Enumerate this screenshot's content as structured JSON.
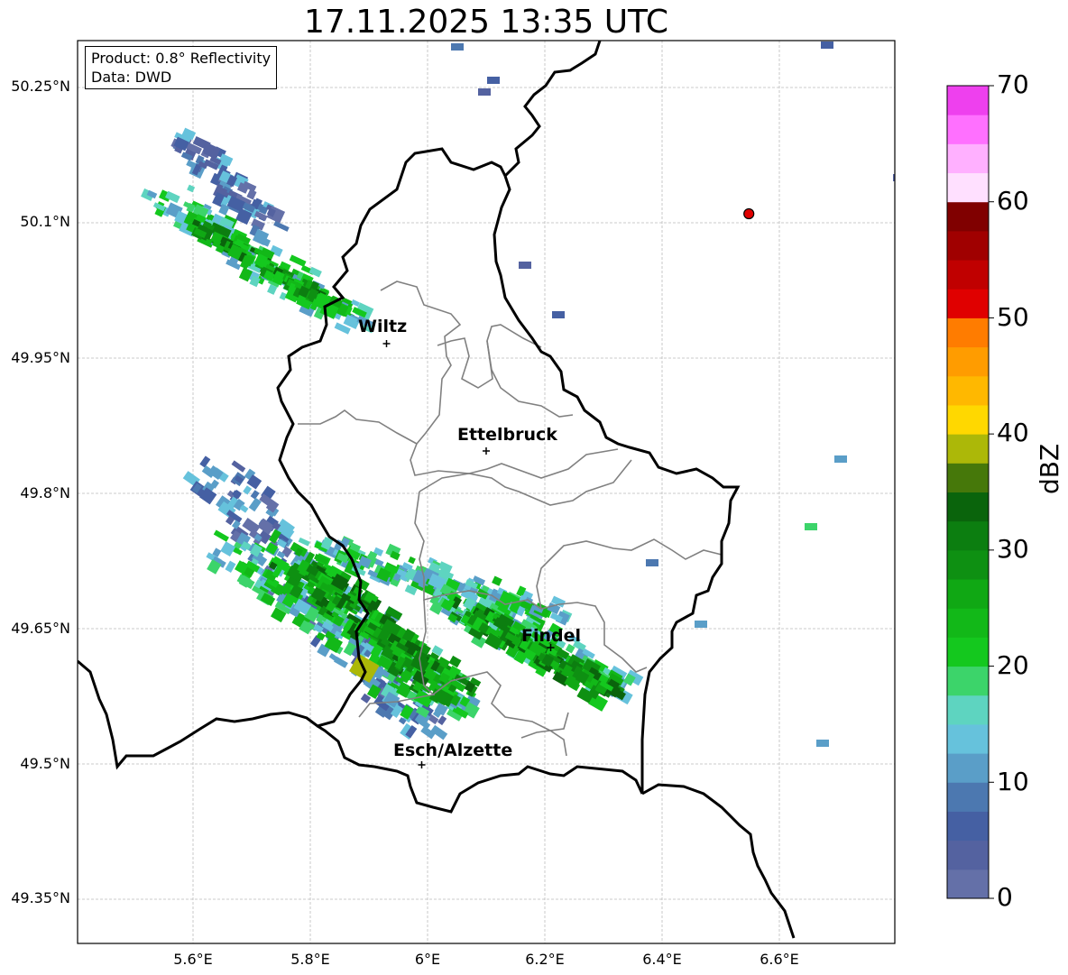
{
  "title": "17.11.2025 13:35 UTC",
  "info_box": {
    "product": "Product: 0.8° Reflectivity",
    "source": "Data: DWD"
  },
  "cities": [
    {
      "name": "Wiltz",
      "lon": 5.93,
      "lat": 49.966
    },
    {
      "name": "Ettelbruck",
      "lon": 6.1,
      "lat": 49.847
    },
    {
      "name": "Findel",
      "lon": 6.21,
      "lat": 49.629
    },
    {
      "name": "Esch/Alzette",
      "lon": 5.99,
      "lat": 49.499
    }
  ],
  "radar_site": {
    "lon": 6.548,
    "lat": 50.11,
    "color": "#e00000"
  },
  "lat_ticks": [
    "50.25°N",
    "50.1°N",
    "49.95°N",
    "49.8°N",
    "49.65°N",
    "49.5°N",
    "49.35°N"
  ],
  "lon_ticks": [
    "5.6°E",
    "5.8°E",
    "6°E",
    "6.2°E",
    "6.4°E",
    "6.6°E"
  ],
  "colorbar": {
    "label": "dBZ",
    "ticks": [
      "0",
      "10",
      "20",
      "30",
      "40",
      "50",
      "60",
      "70"
    ],
    "colors": [
      "#6470a8",
      "#5462a0",
      "#4560a3",
      "#4c78b0",
      "#5a9ec8",
      "#66c2dc",
      "#5ed4c0",
      "#3cd46a",
      "#14c81e",
      "#12b818",
      "#10a814",
      "#0e9012",
      "#0c7e10",
      "#0a640c",
      "#46780a",
      "#acb808",
      "#ffd800",
      "#ffb800",
      "#ff9c00",
      "#ff7c00",
      "#e00000",
      "#c00000",
      "#a00000",
      "#800000",
      "#ffe0ff",
      "#ffb0ff",
      "#ff70ff",
      "#ee40ee"
    ]
  }
}
